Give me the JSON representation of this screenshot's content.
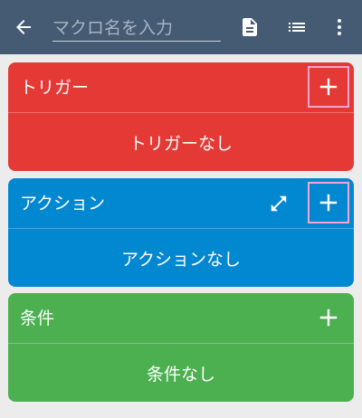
{
  "toolbar": {
    "back_icon": "arrow-left-icon",
    "name_placeholder": "マクロ名を入力",
    "name_value": "",
    "actions": [
      "document-icon",
      "list-icon",
      "more-vert-icon"
    ]
  },
  "colors": {
    "appbar": "#455a73",
    "trigger": "#e53935",
    "action": "#0288d1",
    "condition": "#4caf50"
  },
  "cards": {
    "trigger": {
      "title": "トリガー",
      "empty_text": "トリガーなし",
      "add_icon": "plus-icon"
    },
    "action": {
      "title": "アクション",
      "empty_text": "アクションなし",
      "add_icon": "plus-icon",
      "expand_icon": "expand-icon"
    },
    "condition": {
      "title": "条件",
      "empty_text": "条件なし",
      "add_icon": "plus-icon"
    }
  }
}
